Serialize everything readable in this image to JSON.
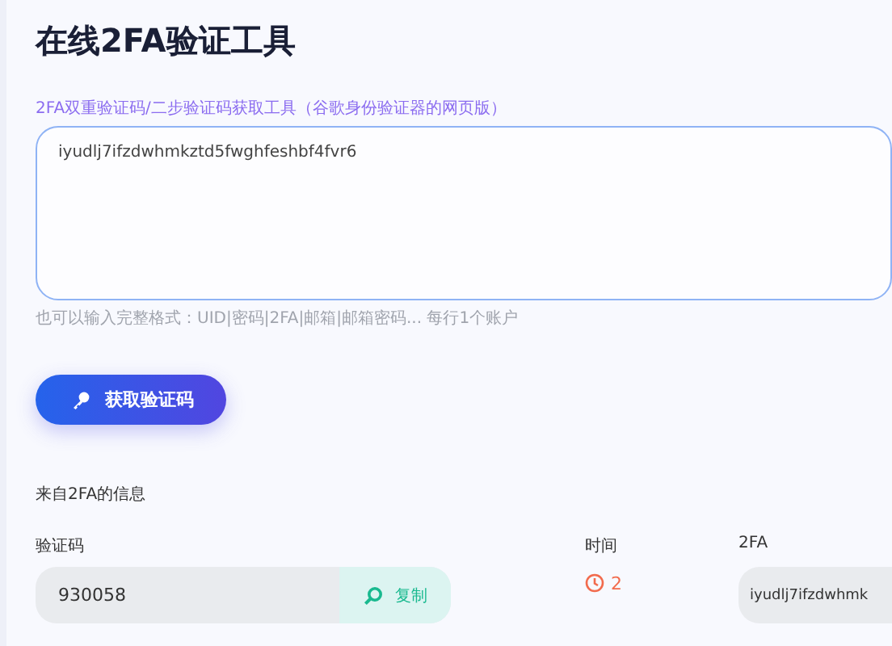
{
  "title": "在线2FA验证工具",
  "subtitle": "2FA双重验证码/二步验证码获取工具（谷歌身份验证器的网页版）",
  "secret_input": {
    "value": "iyudlj7ifzdwhmkztd5fwghfeshbf4fvr6"
  },
  "hint": "也可以输入完整格式：UID|密码|2FA|邮箱|邮箱密码... 每行1个账户",
  "get_code_button": "获取验证码",
  "result": {
    "heading": "来自2FA的信息",
    "code_label": "验证码",
    "code": "930058",
    "copy_button": "复制",
    "time_label": "时间",
    "time": "2",
    "secret_label": "2FA",
    "secret": "iyudlj7ifzdwhmk"
  }
}
